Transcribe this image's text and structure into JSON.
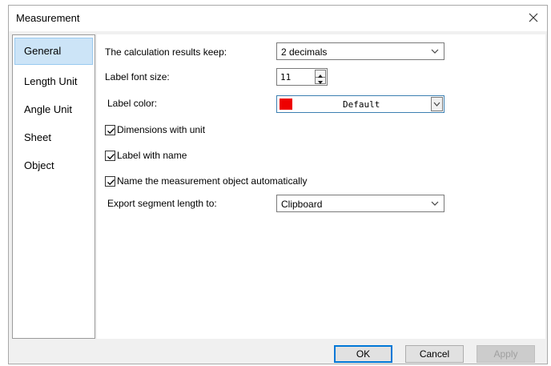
{
  "dialog": {
    "title": "Measurement"
  },
  "sidebar": {
    "items": [
      {
        "label": "General",
        "selected": true
      },
      {
        "label": "Length Unit",
        "selected": false
      },
      {
        "label": "Angle Unit",
        "selected": false
      },
      {
        "label": "Sheet",
        "selected": false
      },
      {
        "label": "Object",
        "selected": false
      }
    ]
  },
  "general": {
    "calc_label": "The calculation results keep:",
    "calc_value": "2 decimals",
    "font_label": "Label font size:",
    "font_value": "11",
    "color_label": "Label color:",
    "color_value": "Default",
    "color_swatch": "#ee0000",
    "dimensions_unit": {
      "label": "Dimensions with unit",
      "checked": true
    },
    "label_name": {
      "label": "Label with name",
      "checked": true
    },
    "auto_name": {
      "label": "Name the measurement object automatically",
      "checked": true
    },
    "export_label": "Export segment length to:",
    "export_value": "Clipboard"
  },
  "buttons": {
    "ok": "OK",
    "cancel": "Cancel",
    "apply": "Apply"
  },
  "icons": {
    "close": "close-icon",
    "dropdown": "chevron-down-icon",
    "check": "checkmark-icon"
  }
}
